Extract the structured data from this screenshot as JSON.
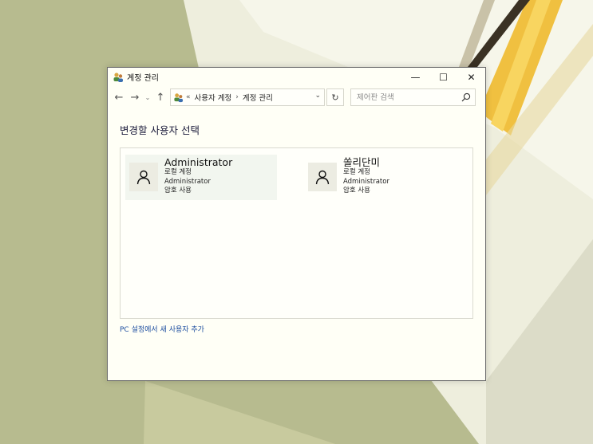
{
  "window": {
    "title": "계정 관리",
    "controls": {
      "minimize": "—",
      "maximize": "☐",
      "close": "✕"
    }
  },
  "nav": {
    "back": "←",
    "forward": "→",
    "recent": "⌄",
    "up": "↑",
    "address": {
      "overflow": "«",
      "segments": [
        "사용자 계정",
        "계정 관리"
      ],
      "separator": "›",
      "dropdown": "⌄"
    },
    "refresh": "↻",
    "search_placeholder": "제어판 검색"
  },
  "main": {
    "heading": "변경할 사용자 선택",
    "users": [
      {
        "name": "Administrator",
        "type": "로컬 계정",
        "group": "Administrator",
        "password": "암호 사용"
      },
      {
        "name": "쏠리단미",
        "type": "로컬 계정",
        "group": "Administrator",
        "password": "암호 사용"
      }
    ],
    "add_user_link": "PC 설정에서 새 사용자 추가"
  },
  "colors": {
    "link": "#1f4fa0",
    "window_bg": "#fffff6",
    "selected_tile": "#f2f6ef"
  }
}
